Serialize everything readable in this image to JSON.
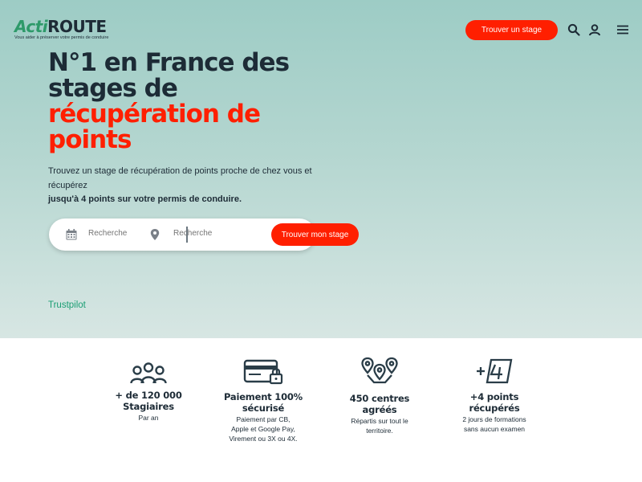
{
  "header": {
    "logo_acti": "Acti",
    "logo_route": "ROUTE",
    "logo_tagline": "Vous aider à préserver votre permis de conduire",
    "cta_label": "Trouver un stage",
    "icons": [
      "search-icon",
      "user-icon",
      "menu-icon"
    ]
  },
  "hero": {
    "headline_lines": [
      "N°1 en France des",
      "stages de"
    ],
    "headline_accent_lines": [
      "récupération de",
      "points"
    ],
    "subtitle_line1": "Trouvez un stage de récupération de points proche de chez vous et",
    "subtitle_line2": "récupérez",
    "subtitle_strong": "jusqu'à 4 points sur votre permis de conduire."
  },
  "search": {
    "date_placeholder": "Recherche",
    "location_placeholder": "Recherche",
    "button_label": "Trouver mon stage"
  },
  "trustpilot": {
    "label": "Trustpilot"
  },
  "features": [
    {
      "icon": "group-icon",
      "title_lines": [
        "+ de 120 000",
        "Stagiaires"
      ],
      "desc_lines": [
        "Par an"
      ]
    },
    {
      "icon": "secure-card-icon",
      "title_lines": [
        "Paiement 100%",
        "sécurisé"
      ],
      "desc_lines": [
        "Paiement par CB,",
        "Apple et Google Pay,",
        "Virement ou 3X ou 4X."
      ]
    },
    {
      "icon": "map-pins-icon",
      "title_lines": [
        "450 centres",
        "agréés"
      ],
      "desc_lines": [
        "Répartis sur tout le",
        "territoire."
      ]
    },
    {
      "icon": "plus-four-icon",
      "title_lines": [
        "+4 points",
        "récupérés"
      ],
      "desc_lines": [
        "2 jours de formations",
        "sans aucun examen"
      ]
    }
  ],
  "colors": {
    "accent": "#ff1f00",
    "brand_green": "#2e9a6a",
    "dark_text": "#1d2b36",
    "hero_bg_top": "#9dccc5",
    "hero_bg_bottom": "#d7e6e3",
    "trustpilot_green": "#1a9e73"
  }
}
